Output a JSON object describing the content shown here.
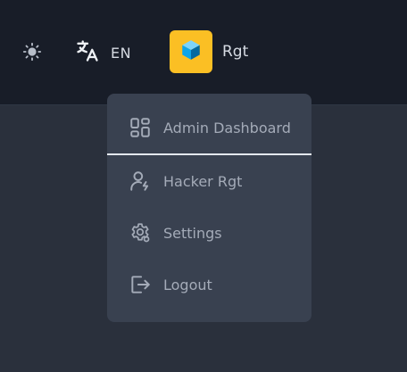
{
  "navbar": {
    "language": {
      "code": "EN",
      "icon": "translate-icon"
    },
    "theme": {
      "icon": "sun-icon"
    },
    "user": {
      "name": "Rgt",
      "avatar_color": "#fbbf24",
      "avatar_icon": "cube-icon"
    }
  },
  "user_menu": {
    "items": [
      {
        "label": "Admin Dashboard",
        "icon": "dashboard-icon"
      },
      {
        "label": "Hacker Rgt",
        "icon": "user-icon"
      },
      {
        "label": "Settings",
        "icon": "gear-icon"
      },
      {
        "label": "Logout",
        "icon": "logout-icon"
      }
    ]
  },
  "colors": {
    "navbar_bg": "#181d28",
    "page_bg": "#2a303c",
    "menu_bg": "#394150",
    "menu_text": "#a4abb8",
    "nav_text": "#d6dbe3"
  }
}
